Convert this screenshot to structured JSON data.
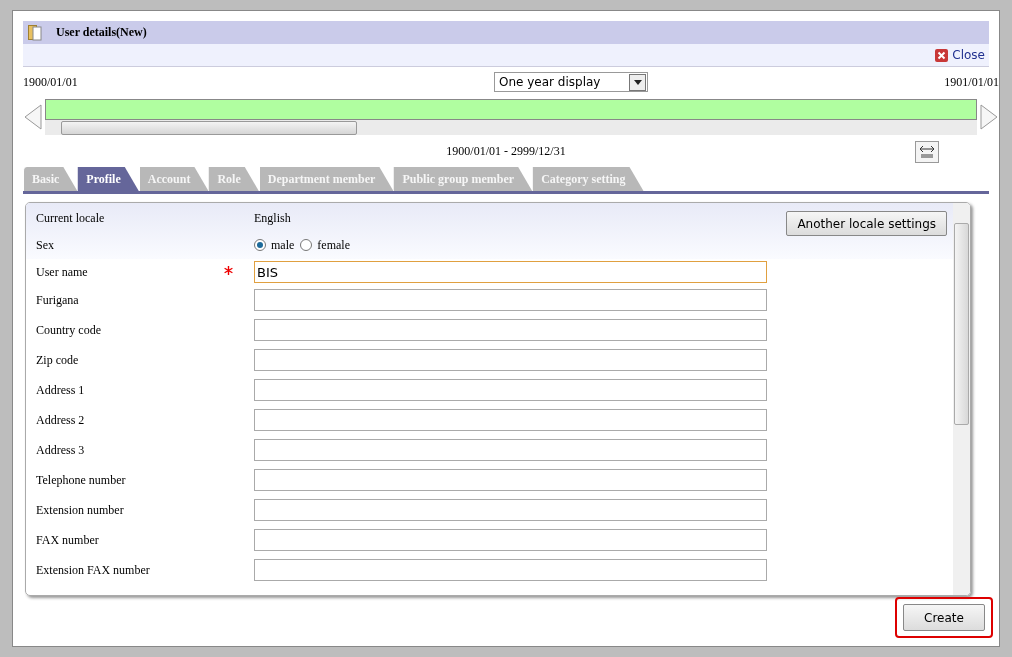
{
  "window": {
    "title": "User details(New)",
    "close": "Close"
  },
  "timeline": {
    "start": "1900/01/01",
    "end": "1901/01/01",
    "display": "One year display",
    "range": "1900/01/01 - 2999/12/31"
  },
  "tabs": [
    {
      "label": "Basic",
      "selected": false
    },
    {
      "label": "Profile",
      "selected": true
    },
    {
      "label": "Account",
      "selected": false
    },
    {
      "label": "Role",
      "selected": false
    },
    {
      "label": "Department member",
      "selected": false
    },
    {
      "label": "Public group member",
      "selected": false
    },
    {
      "label": "Category setting",
      "selected": false
    }
  ],
  "locale": {
    "label": "Current locale",
    "value": "English",
    "button": "Another locale settings"
  },
  "sex": {
    "label": "Sex",
    "options": [
      {
        "label": "male",
        "selected": true
      },
      {
        "label": "female",
        "selected": false
      }
    ]
  },
  "fields": [
    {
      "label": "User name",
      "required": true,
      "value": "BIS",
      "focused": true
    },
    {
      "label": "Furigana",
      "required": false,
      "focused": false
    },
    {
      "label": "Country code",
      "required": false,
      "focused": false
    },
    {
      "label": "Zip code",
      "required": false,
      "focused": false
    },
    {
      "label": "Address 1",
      "required": false,
      "focused": false
    },
    {
      "label": "Address 2",
      "required": false,
      "focused": false
    },
    {
      "label": "Address 3",
      "required": false,
      "focused": false
    },
    {
      "label": "Telephone number",
      "required": false,
      "focused": false
    },
    {
      "label": "Extension number",
      "required": false,
      "focused": false
    },
    {
      "label": "FAX number",
      "required": false,
      "focused": false
    },
    {
      "label": "Extension FAX number",
      "required": false,
      "focused": false
    }
  ],
  "footer": {
    "create": "Create",
    "highlighted": true
  }
}
